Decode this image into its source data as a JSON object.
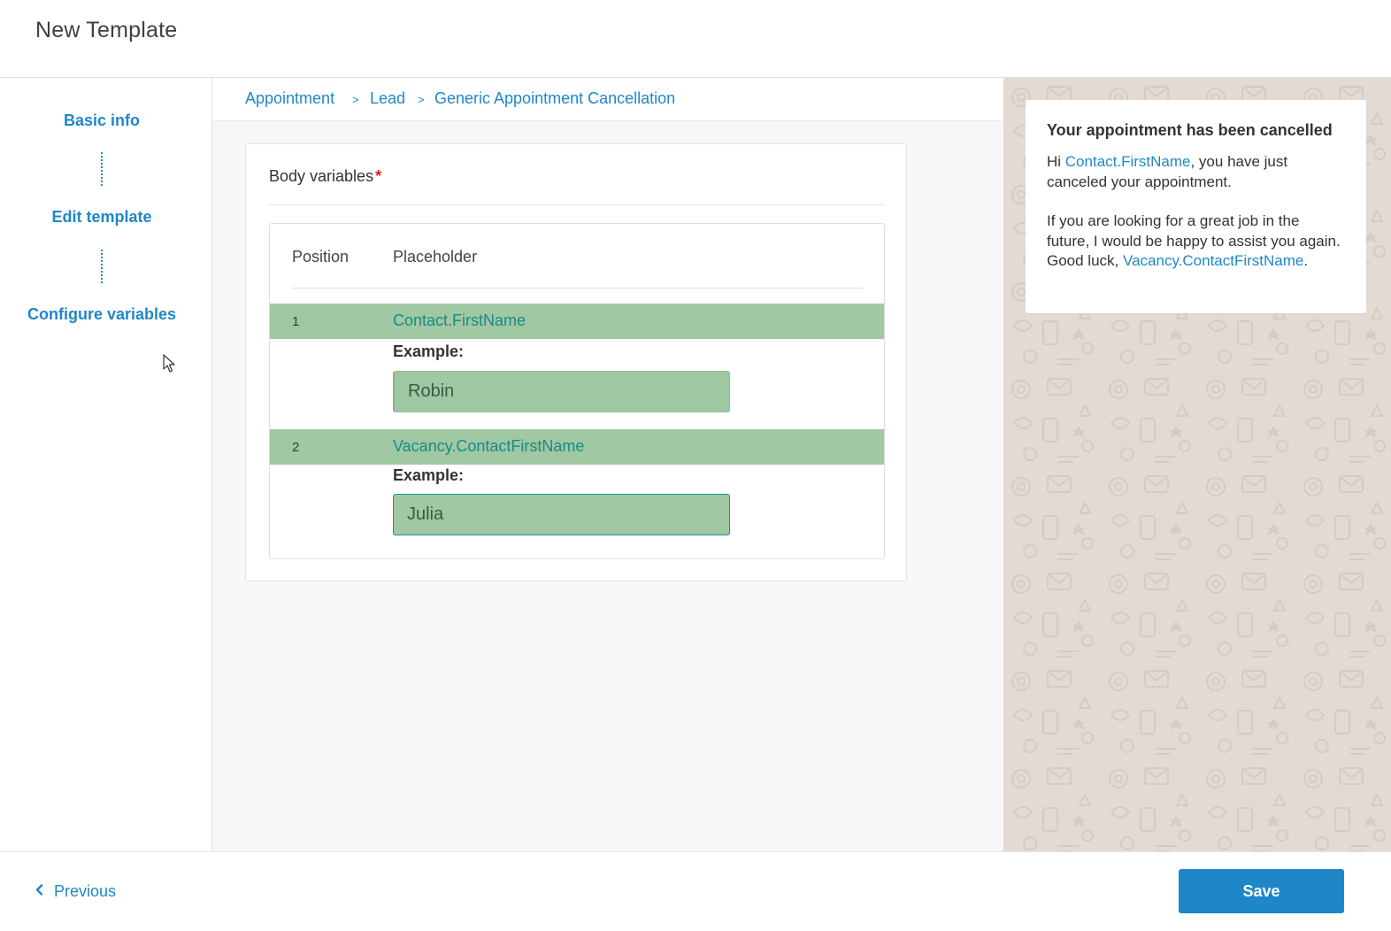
{
  "header": {
    "title": "New Template"
  },
  "sidebar": {
    "steps": [
      {
        "label": "Basic info"
      },
      {
        "label": "Edit template"
      },
      {
        "label": "Configure variables"
      }
    ]
  },
  "breadcrumb": {
    "items": [
      "Appointment",
      "Lead",
      "Generic Appointment Cancellation"
    ],
    "separator": ">"
  },
  "body_variables": {
    "title": "Body variables",
    "required_marker": "*",
    "columns": {
      "position": "Position",
      "placeholder": "Placeholder"
    },
    "rows": [
      {
        "position": "1",
        "placeholder": "Contact.FirstName",
        "example_label": "Example:",
        "example_value": "Robin"
      },
      {
        "position": "2",
        "placeholder": "Vacancy.ContactFirstName",
        "example_label": "Example:",
        "example_value": "Julia"
      }
    ]
  },
  "preview": {
    "title": "Your appointment has been cancelled",
    "p1_prefix": "Hi ",
    "p1_var": "Contact.FirstName",
    "p1_suffix": ", you have just canceled your appointment.",
    "p2_text": "If you are looking for a great job in the future, I would be happy to assist you again. Good luck, ",
    "p2_var": "Vacancy.ContactFirstName",
    "p2_suffix": "."
  },
  "footer": {
    "previous_label": "Previous",
    "save_label": "Save"
  },
  "colors": {
    "accent": "#1f87c8",
    "row_highlight": "#9fc8a3",
    "placeholder_text": "#1b8a86",
    "required": "#e02020",
    "preview_bg": "#e3dbd3"
  },
  "icons": {
    "previous": "chevron-left-icon",
    "cursor": "mouse-pointer-icon"
  }
}
